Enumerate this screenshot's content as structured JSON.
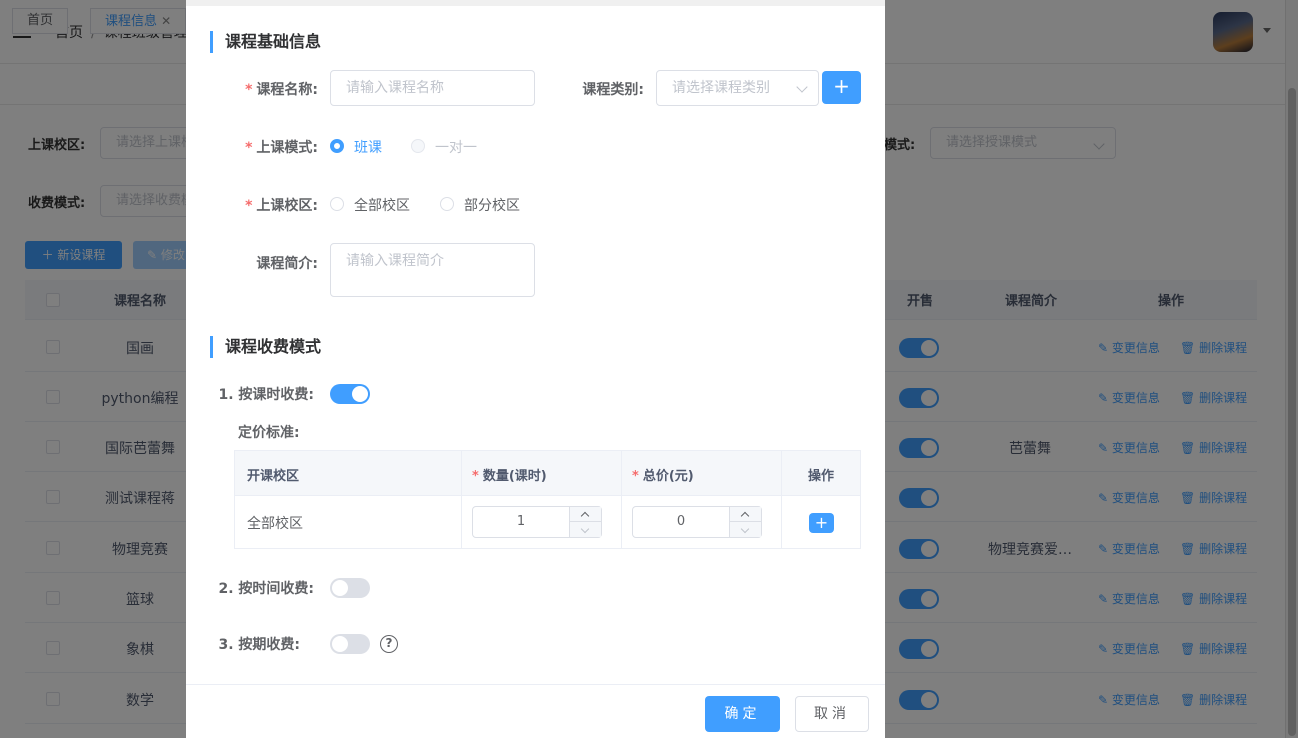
{
  "header": {
    "breadcrumb": [
      "首页",
      "课程班级管理"
    ],
    "separator": "/"
  },
  "tabs": [
    {
      "label": "首页"
    },
    {
      "label": "课程信息",
      "close": "✕"
    }
  ],
  "filters": {
    "campus_label": "上课校区:",
    "campus_placeholder": "请选择上课校区",
    "mode_label": "模式:",
    "mode_placeholder": "请选择授课模式",
    "fee_label": "收费模式:",
    "fee_placeholder": "请选择收费模式"
  },
  "toolbar": {
    "new_label": "新设课程",
    "edit_label": "修改"
  },
  "table": {
    "columns": {
      "name": "课程名称",
      "sale": "开售",
      "intro": "课程简介",
      "ops": "操作"
    },
    "rows": [
      {
        "name": "国画",
        "intro": ""
      },
      {
        "name": "python编程",
        "intro": ""
      },
      {
        "name": "国际芭蕾舞",
        "intro": "芭蕾舞"
      },
      {
        "name": "测试课程蒋",
        "intro": ""
      },
      {
        "name": "物理竞赛",
        "intro": "物理竞赛爱…"
      },
      {
        "name": "篮球",
        "intro": ""
      },
      {
        "name": "象棋",
        "intro": ""
      },
      {
        "name": "数学",
        "intro": ""
      }
    ],
    "edit_action": "变更信息",
    "delete_action": "删除课程"
  },
  "modal": {
    "basic_title": "课程基础信息",
    "name_label": "课程名称:",
    "name_placeholder": "请输入课程名称",
    "category_label": "课程类别:",
    "category_placeholder": "请选择课程类别",
    "add_symbol": "+",
    "mode_label": "上课模式:",
    "mode_options": [
      "班课",
      "一对一"
    ],
    "mode_selected": "班课",
    "campus_label": "上课校区:",
    "campus_options": [
      "全部校区",
      "部分校区"
    ],
    "intro_label": "课程简介:",
    "intro_placeholder": "请输入课程简介",
    "required_mark": "*",
    "fee_title": "课程收费模式",
    "fee_by_lesson_label": "1. 按课时收费:",
    "fee_by_lesson_on": true,
    "pricing_label": "定价标准:",
    "pricing_columns": {
      "campus": "开课校区",
      "qty": "数量(课时)",
      "total": "总价(元)",
      "ops": "操作"
    },
    "pricing_row": {
      "campus": "全部校区",
      "qty": "1",
      "total": "0"
    },
    "fee_by_time_label": "2. 按时间收费:",
    "fee_by_time_on": false,
    "fee_by_term_label": "3. 按期收费:",
    "fee_by_term_on": false,
    "help_symbol": "?",
    "ok_label": "确定",
    "cancel_label": "取消"
  }
}
